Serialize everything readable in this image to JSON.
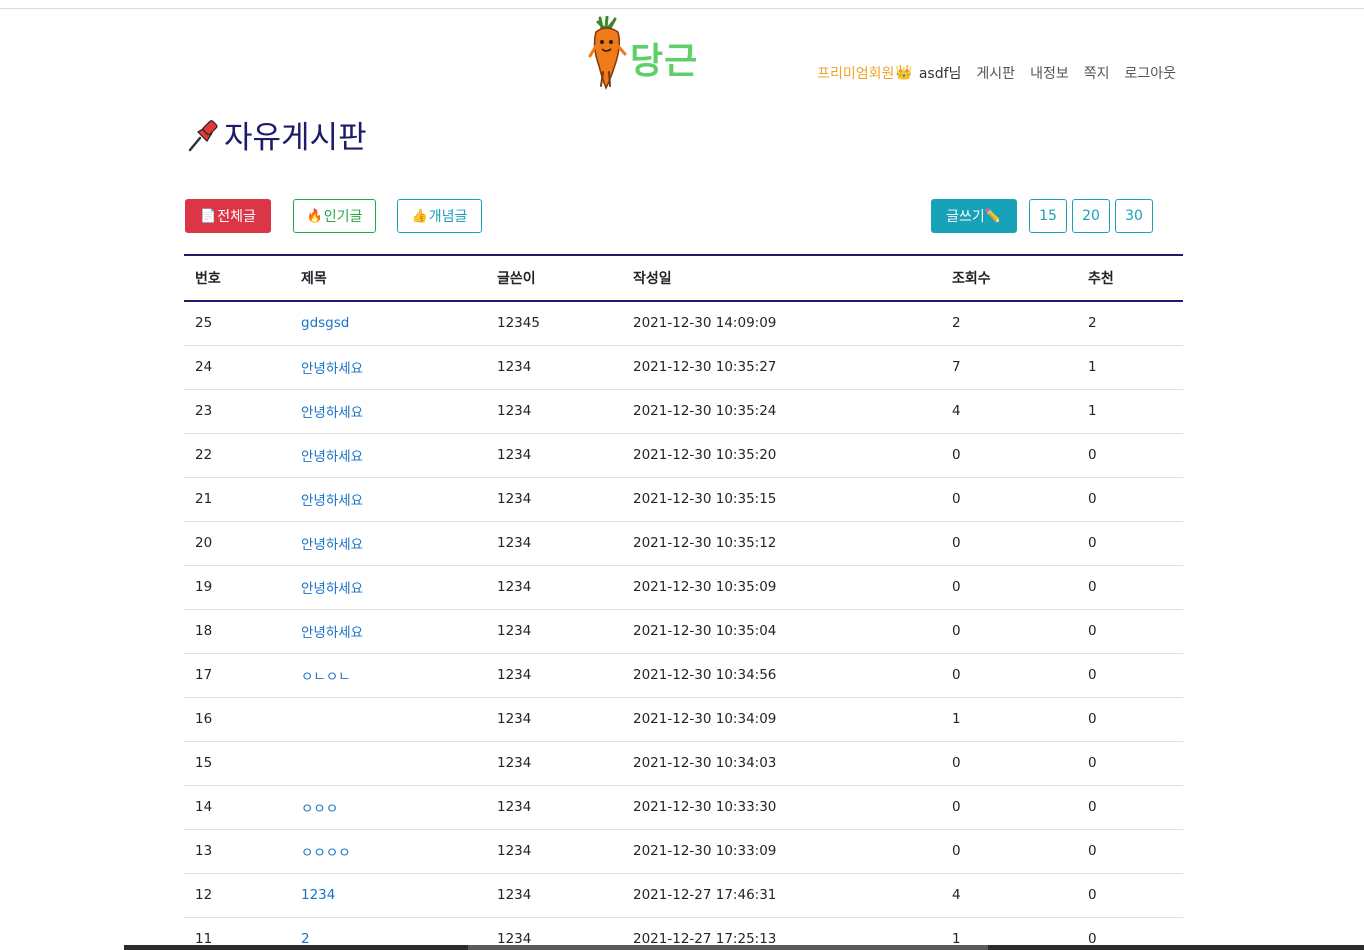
{
  "header": {
    "logo_text": "당근",
    "premium_label": "프리미엄회원",
    "crown_icon": "crown-icon",
    "username": "asdf님",
    "nav_links": [
      "게시판",
      "내정보",
      "쪽지",
      "로그아웃"
    ]
  },
  "page": {
    "title": "자유게시판"
  },
  "filters": {
    "all_label": "전체글",
    "hot_label": "인기글",
    "best_label": "개념글",
    "write_label": "글쓰기",
    "page_sizes": [
      "15",
      "20",
      "30"
    ]
  },
  "colors": {
    "all": "#dc3545",
    "hot": "#28a745",
    "best": "#17a2b8",
    "write": "#17a2b8",
    "title_link": "#1a73c8",
    "heading": "#1c1c6b",
    "premium": "#f0a32a",
    "logo_green": "#5fd068"
  },
  "table": {
    "columns": [
      "번호",
      "제목",
      "글쓴이",
      "작성일",
      "조회수",
      "추천"
    ],
    "rows": [
      {
        "no": "25",
        "title": "gdsgsd",
        "writer": "12345",
        "date": "2021-12-30 14:09:09",
        "views": "2",
        "recommend": "2"
      },
      {
        "no": "24",
        "title": "안녕하세요",
        "writer": "1234",
        "date": "2021-12-30 10:35:27",
        "views": "7",
        "recommend": "1"
      },
      {
        "no": "23",
        "title": "안녕하세요",
        "writer": "1234",
        "date": "2021-12-30 10:35:24",
        "views": "4",
        "recommend": "1"
      },
      {
        "no": "22",
        "title": "안녕하세요",
        "writer": "1234",
        "date": "2021-12-30 10:35:20",
        "views": "0",
        "recommend": "0"
      },
      {
        "no": "21",
        "title": "안녕하세요",
        "writer": "1234",
        "date": "2021-12-30 10:35:15",
        "views": "0",
        "recommend": "0"
      },
      {
        "no": "20",
        "title": "안녕하세요",
        "writer": "1234",
        "date": "2021-12-30 10:35:12",
        "views": "0",
        "recommend": "0"
      },
      {
        "no": "19",
        "title": "안녕하세요",
        "writer": "1234",
        "date": "2021-12-30 10:35:09",
        "views": "0",
        "recommend": "0"
      },
      {
        "no": "18",
        "title": "안녕하세요",
        "writer": "1234",
        "date": "2021-12-30 10:35:04",
        "views": "0",
        "recommend": "0"
      },
      {
        "no": "17",
        "title": "ㅇㄴㅇㄴ",
        "writer": "1234",
        "date": "2021-12-30 10:34:56",
        "views": "0",
        "recommend": "0"
      },
      {
        "no": "16",
        "title": "",
        "writer": "1234",
        "date": "2021-12-30 10:34:09",
        "views": "1",
        "recommend": "0"
      },
      {
        "no": "15",
        "title": "",
        "writer": "1234",
        "date": "2021-12-30 10:34:03",
        "views": "0",
        "recommend": "0"
      },
      {
        "no": "14",
        "title": "ㅇㅇㅇ",
        "writer": "1234",
        "date": "2021-12-30 10:33:30",
        "views": "0",
        "recommend": "0"
      },
      {
        "no": "13",
        "title": "ㅇㅇㅇㅇ",
        "writer": "1234",
        "date": "2021-12-30 10:33:09",
        "views": "0",
        "recommend": "0"
      },
      {
        "no": "12",
        "title": "1234",
        "writer": "1234",
        "date": "2021-12-27 17:46:31",
        "views": "4",
        "recommend": "0"
      },
      {
        "no": "11",
        "title": "2",
        "writer": "1234",
        "date": "2021-12-27 17:25:13",
        "views": "1",
        "recommend": "0"
      }
    ]
  }
}
